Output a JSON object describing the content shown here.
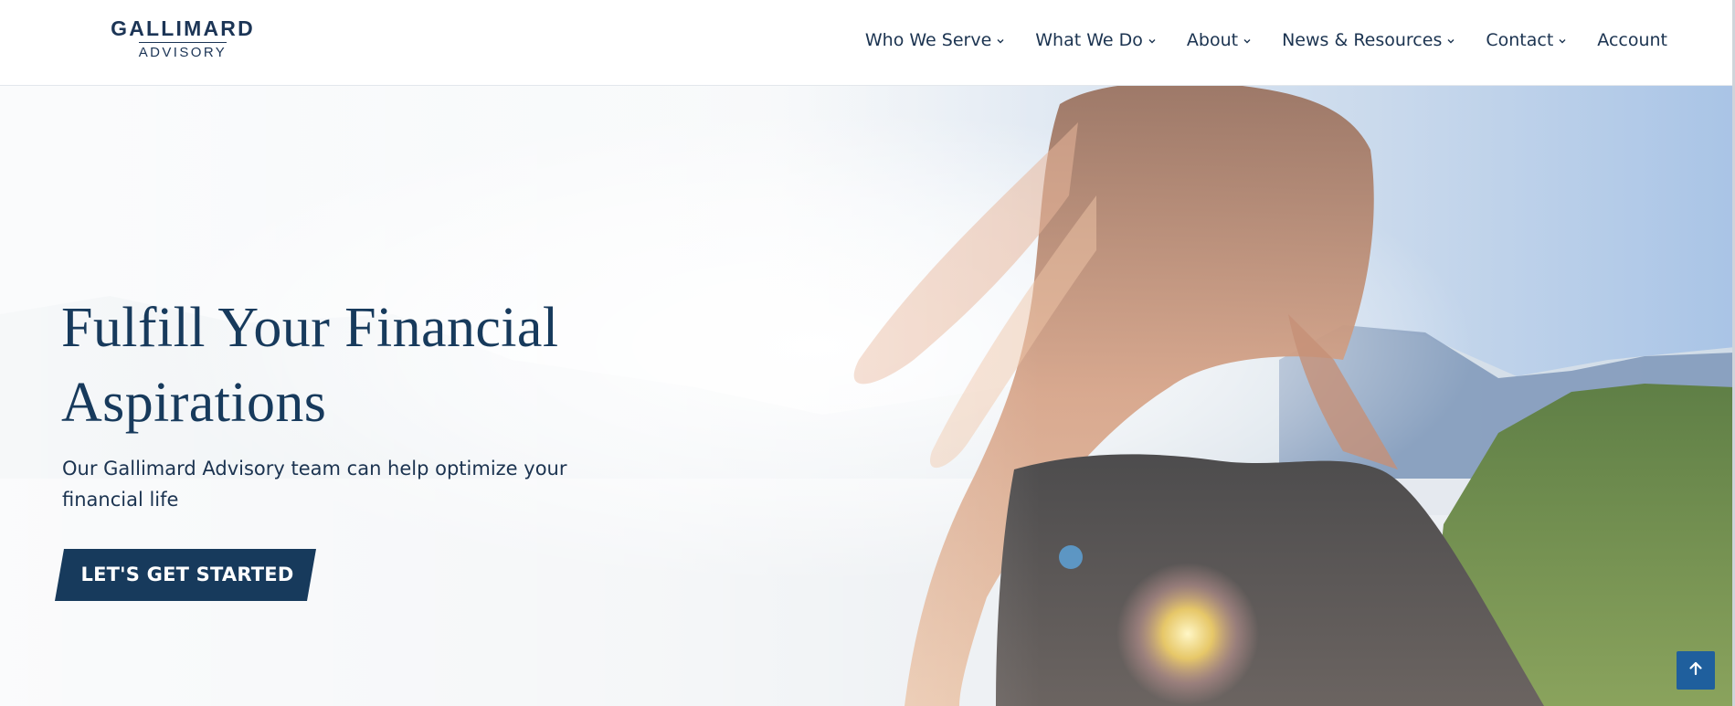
{
  "brand": {
    "name": "GALLIMARD",
    "sub": "ADVISORY"
  },
  "nav": {
    "items": [
      {
        "label": "Who We Serve",
        "has_dropdown": true
      },
      {
        "label": "What We Do",
        "has_dropdown": true
      },
      {
        "label": "About",
        "has_dropdown": true
      },
      {
        "label": "News & Resources",
        "has_dropdown": true
      },
      {
        "label": "Contact",
        "has_dropdown": true
      },
      {
        "label": "Account",
        "has_dropdown": false
      }
    ]
  },
  "hero": {
    "title": "Fulfill Your Financial Aspirations",
    "subtitle": "Our Gallimard Advisory team can help optimize your financial life",
    "cta_label": "LET'S GET STARTED",
    "image_description_icon": "hero-photo"
  },
  "icons": {
    "dropdown": "chevron-down-icon",
    "back_to_top": "arrow-up-icon"
  },
  "colors": {
    "brand_navy": "#173a5c",
    "text_navy": "#1b3350",
    "back_to_top_blue": "#1f5f9d",
    "header_bg": "#ffffff"
  }
}
